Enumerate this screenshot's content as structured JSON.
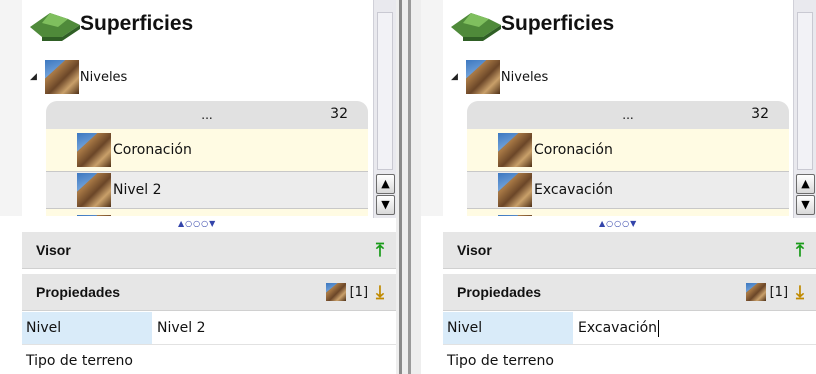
{
  "left_panel": {
    "title": "Superficies",
    "group_label": "Niveles",
    "list_header_dots": "...",
    "list_count": "32",
    "items": [
      {
        "label": "Coronación"
      },
      {
        "label": "Nivel 2"
      },
      {
        "label": ""
      }
    ],
    "pager": "▲○○○▼",
    "visor_label": "Visor",
    "props_label": "Propiedades",
    "props_count": "[1]",
    "properties": [
      {
        "name": "Nivel",
        "value": "Nivel 2"
      },
      {
        "name": "Tipo de terreno",
        "value": ""
      }
    ]
  },
  "right_panel": {
    "title": "Superficies",
    "group_label": "Niveles",
    "list_header_dots": "...",
    "list_count": "32",
    "items": [
      {
        "label": "Coronación"
      },
      {
        "label": "Excavación"
      },
      {
        "label": ""
      }
    ],
    "pager": "▲○○○▼",
    "visor_label": "Visor",
    "props_label": "Propiedades",
    "props_count": "[1]",
    "properties": [
      {
        "name": "Nivel",
        "value": "Excavación"
      },
      {
        "name": "Tipo de terreno",
        "value": ""
      }
    ]
  },
  "icons": {
    "title": "terrain-icon",
    "texture": "rock-texture-icon",
    "expander": "collapse-triangle-icon",
    "visor_action": "arrow-up-green-icon",
    "props_action": "arrow-down-orange-icon",
    "scroll_up": "scroll-up-icon",
    "scroll_down": "scroll-down-icon"
  },
  "colors": {
    "list_background": "#fffbe3",
    "selection": "#d9ebf9",
    "section_header": "#e6e6e6",
    "visor_arrow": "#1a9b1a",
    "props_arrow": "#c08a00"
  }
}
